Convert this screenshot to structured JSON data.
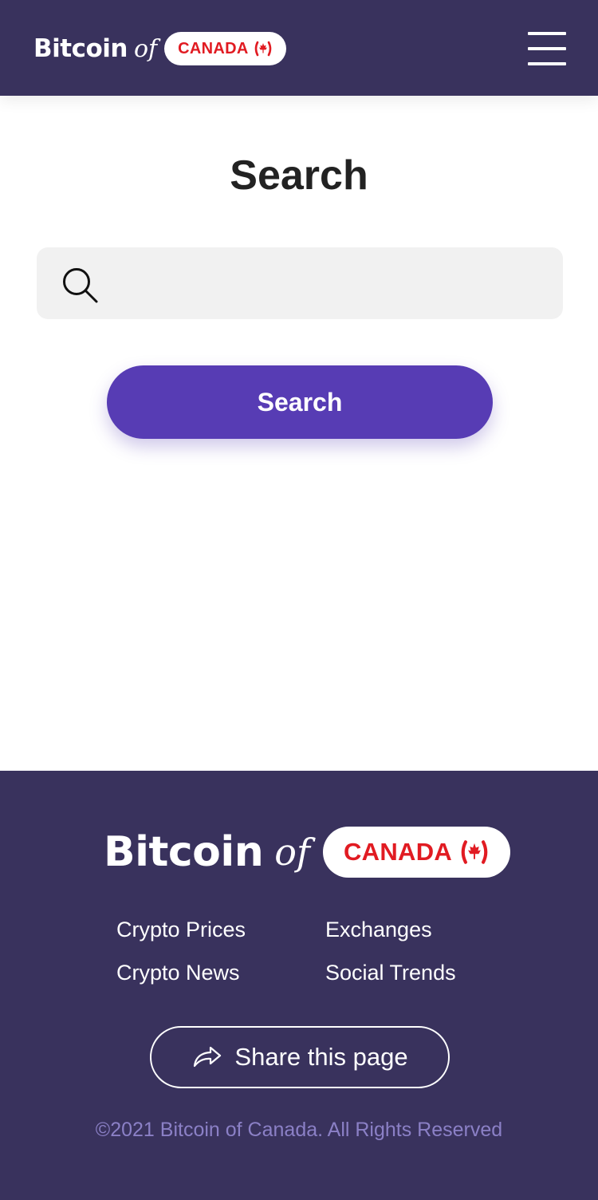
{
  "header": {
    "logo": {
      "bitcoin": "Bitcoin",
      "of": "of",
      "country": "CANADA"
    },
    "menu_icon": "hamburger-menu-icon"
  },
  "main": {
    "title": "Search",
    "search": {
      "value": "",
      "placeholder": "",
      "icon": "search-icon"
    },
    "search_button_label": "Search"
  },
  "footer": {
    "logo": {
      "bitcoin": "Bitcoin",
      "of": "of",
      "country": "CANADA"
    },
    "links": [
      "Crypto Prices",
      "Exchanges",
      "Crypto News",
      "Social Trends"
    ],
    "share_label": "Share this page",
    "share_icon": "share-arrow-icon",
    "copyright": "©2021 Bitcoin of Canada. All Rights Reserved"
  },
  "colors": {
    "header_bg": "#39325d",
    "accent": "#573cb4",
    "brand_red": "#e11b22",
    "copyright_text": "#8b80c6",
    "search_bg": "#f1f1f1"
  }
}
